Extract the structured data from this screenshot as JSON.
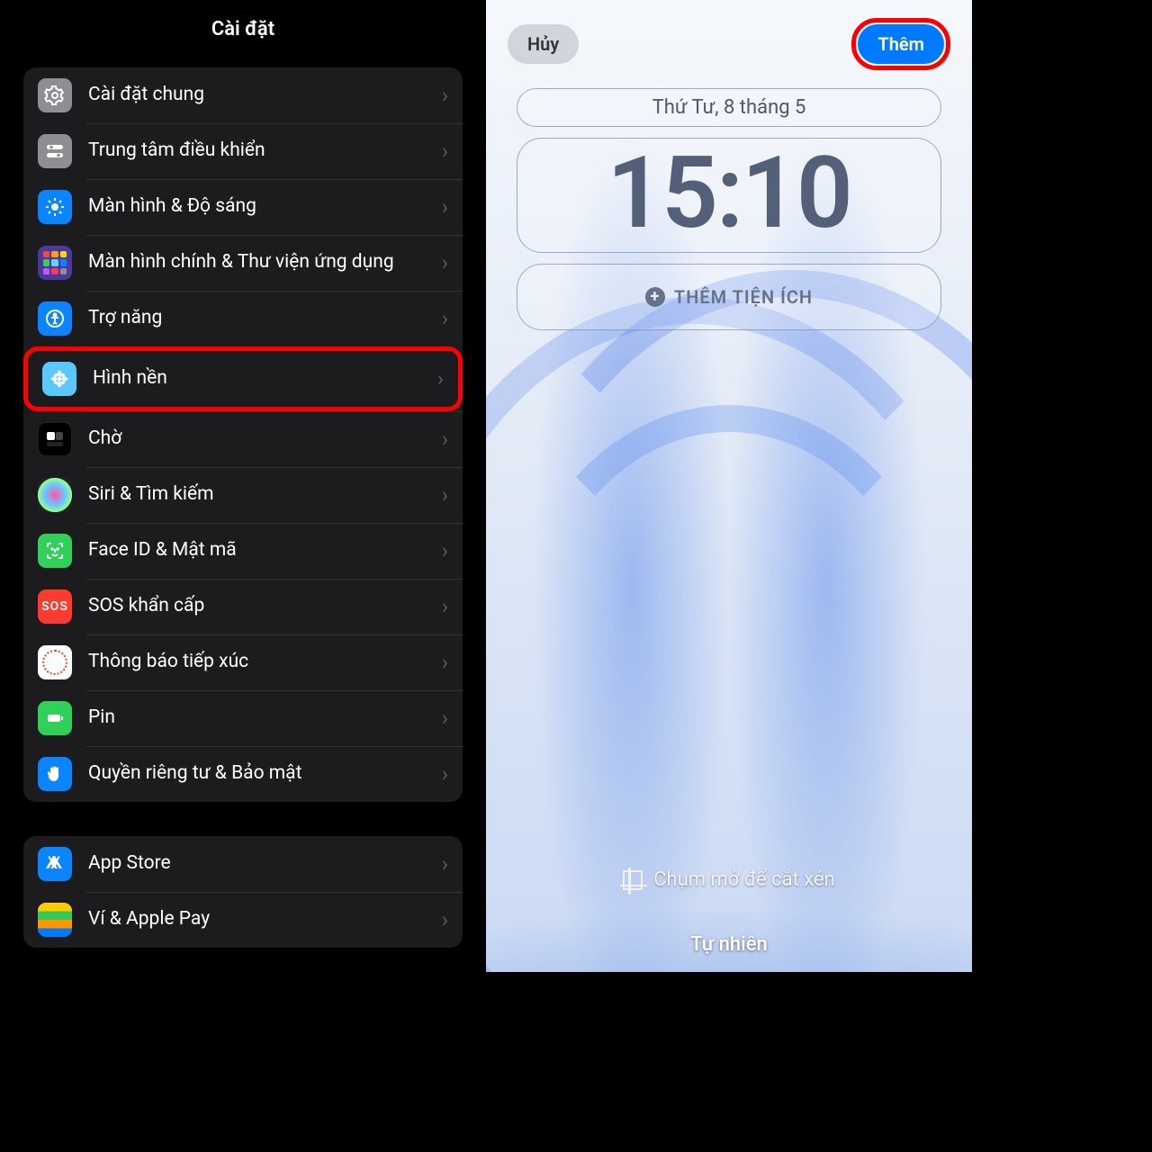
{
  "settings": {
    "title": "Cài đặt",
    "group1": [
      {
        "key": "general",
        "label": "Cài đặt chung",
        "icon": "general"
      },
      {
        "key": "control",
        "label": "Trung tâm điều khiển",
        "icon": "control"
      },
      {
        "key": "brightness",
        "label": "Màn hình & Độ sáng",
        "icon": "brightness"
      },
      {
        "key": "home",
        "label": "Màn hình chính & Thư viện ứng dụng",
        "icon": "home"
      },
      {
        "key": "access",
        "label": "Trợ năng",
        "icon": "access"
      },
      {
        "key": "wallpaper",
        "label": "Hình nền",
        "icon": "wallpaper",
        "highlighted": true
      },
      {
        "key": "standby",
        "label": "Chờ",
        "icon": "standby"
      },
      {
        "key": "siri",
        "label": "Siri & Tìm kiếm",
        "icon": "siri"
      },
      {
        "key": "faceid",
        "label": "Face ID & Mật mã",
        "icon": "faceid"
      },
      {
        "key": "sos",
        "label": "SOS khẩn cấp",
        "icon": "sos"
      },
      {
        "key": "exposure",
        "label": "Thông báo tiếp xúc",
        "icon": "exposure"
      },
      {
        "key": "battery",
        "label": "Pin",
        "icon": "battery"
      },
      {
        "key": "privacy",
        "label": "Quyền riêng tư & Bảo mật",
        "icon": "privacy"
      }
    ],
    "group2": [
      {
        "key": "appstore",
        "label": "App Store",
        "icon": "appstore"
      },
      {
        "key": "wallet",
        "label": "Ví & Apple Pay",
        "icon": "wallet"
      }
    ]
  },
  "lockscreen": {
    "cancel": "Hủy",
    "add": "Thêm",
    "date": "Thứ Tư, 8 tháng 5",
    "time": "15:10",
    "add_widget": "THÊM TIỆN ÍCH",
    "crop_hint": "Chụm mở để cắt xén",
    "filter": "Tự nhiên"
  }
}
